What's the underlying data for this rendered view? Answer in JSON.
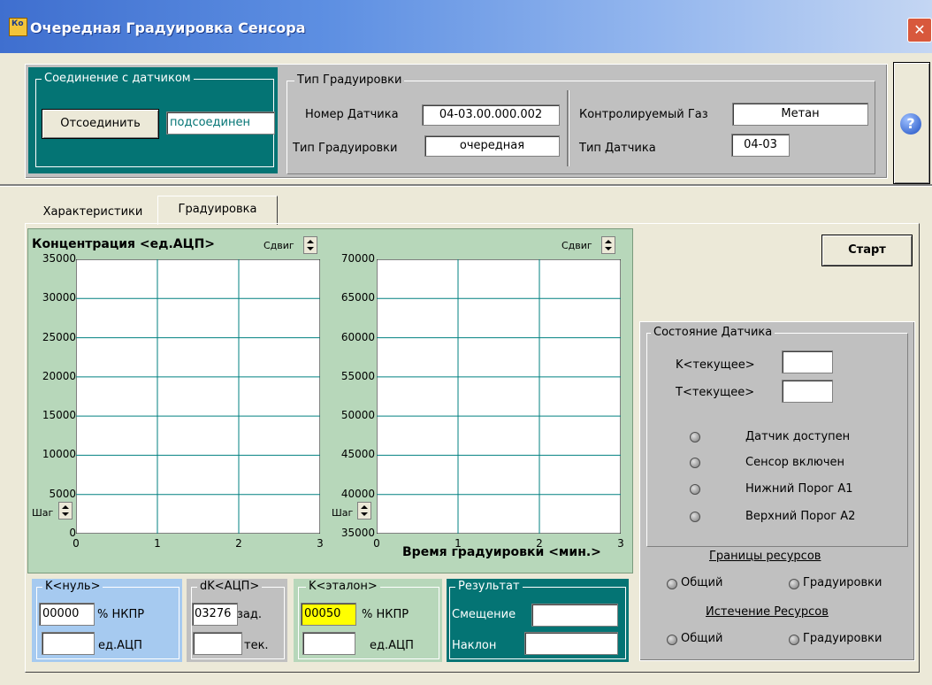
{
  "window": {
    "title": "Очередная Градуировка Сенсора",
    "close": "✕",
    "icon_text": "Ко"
  },
  "connection": {
    "legend": "Соединение с датчиком",
    "disconnect_label": "Отсоединить",
    "status": "подсоединен"
  },
  "calibration_type": {
    "legend": "Тип Градуировки",
    "sensor_number_label": "Номер Датчика",
    "sensor_number": "04-03.00.000.002",
    "type_label": "Тип Градуировки",
    "type_value": "очередная",
    "gas_label": "Контролируемый Газ",
    "gas_value": "Метан",
    "sensor_type_label": "Тип Датчика",
    "sensor_type_value": "04-03"
  },
  "help": {
    "icon": "?"
  },
  "tabs": [
    {
      "label": "Характеристики"
    },
    {
      "label": "Градуировка"
    }
  ],
  "start_label": "Старт",
  "left_chart": {
    "title": "Концентрация <ед.АЦП>",
    "shift_label": "Сдвиг",
    "step_label": "Шаг",
    "y_ticks": [
      "35000",
      "30000",
      "25000",
      "20000",
      "15000",
      "10000",
      "5000",
      "0"
    ],
    "x_ticks": [
      "0",
      "1",
      "2",
      "3"
    ]
  },
  "right_chart": {
    "shift_label": "Сдвиг",
    "step_label": "Шаг",
    "y_ticks": [
      "70000",
      "65000",
      "60000",
      "55000",
      "50000",
      "45000",
      "40000",
      "35000"
    ],
    "x_ticks": [
      "0",
      "1",
      "2",
      "3"
    ],
    "xlabel": "Время градуировки <мин.>"
  },
  "chart_data": [
    {
      "type": "line",
      "title": "Концентрация <ед.АЦП>",
      "xlabel": "",
      "ylabel": "",
      "xlim": [
        0,
        3
      ],
      "ylim": [
        0,
        35000
      ],
      "series": [],
      "grid": true
    },
    {
      "type": "line",
      "title": "",
      "xlabel": "Время градуировки <мин.>",
      "ylabel": "",
      "xlim": [
        0,
        3
      ],
      "ylim": [
        35000,
        70000
      ],
      "series": [],
      "grid": true
    }
  ],
  "sensor_state": {
    "legend": "Состояние Датчика",
    "k_current_label": "K<текущее>",
    "k_current": "",
    "t_current_label": "T<текущее>",
    "t_current": "",
    "indicators": [
      "Датчик доступен",
      "Сенсор включен",
      "Нижний Порог А1",
      "Верхний Порог А2"
    ],
    "resource_limits_label": "Границы ресурсов",
    "resource_expiry_label": "Истечение Ресурсов",
    "common_label": "Общий",
    "calibrations_label": "Градуировки"
  },
  "k_zero": {
    "legend": "K<нуль>",
    "value": "00000",
    "unit1": "% НКПР",
    "value2": "",
    "unit2": "ед.АЦП"
  },
  "dk_adc": {
    "legend": "dK<АЦП>",
    "value": "03276",
    "label1": "зад.",
    "value2": "",
    "label2": "тек."
  },
  "k_ref": {
    "legend": "K<эталон>",
    "value": "00050",
    "unit1": "% НКПР",
    "value2": "",
    "unit2": "ед.АЦП"
  },
  "result": {
    "legend": "Результат",
    "offset_label": "Смещение",
    "offset": "",
    "slope_label": "Наклон",
    "slope": ""
  },
  "colors": {
    "teal": "#047474",
    "highlight_yellow": "#ffff00",
    "grid": "#008080",
    "chart_bg": "#b7d7ba",
    "k_zero_bg": "#a6caf0"
  }
}
